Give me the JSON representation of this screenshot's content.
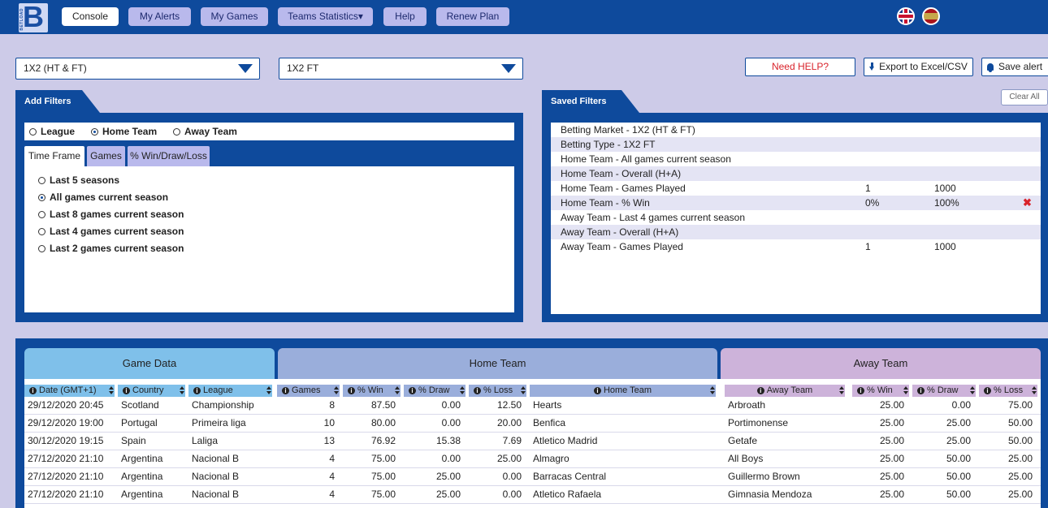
{
  "nav": {
    "logo_letter": "B",
    "logo_sub": "BETLOAD",
    "items": [
      {
        "label": "Console",
        "active": true
      },
      {
        "label": "My Alerts"
      },
      {
        "label": "My Games"
      },
      {
        "label": "Teams Statistics▾"
      },
      {
        "label": "Help"
      },
      {
        "label": "Renew Plan"
      }
    ],
    "flags": [
      "uk-flag",
      "spain-flag"
    ]
  },
  "selects": {
    "betting_market": "1X2 (HT & FT)",
    "betting_type": "1X2 FT"
  },
  "actions": {
    "help": "Need HELP?",
    "export": "Export to Excel/CSV",
    "save_alert": "Save alert"
  },
  "add_filters": {
    "title": "Add Filters",
    "radios": [
      "League",
      "Home Team",
      "Away Team"
    ],
    "selected_radio": "Home Team",
    "tabs": [
      "Time Frame",
      "Games",
      "% Win/Draw/Loss"
    ],
    "active_tab": "Time Frame",
    "options": [
      "Last 5 seasons",
      "All games current season",
      "Last 8 games current season",
      "Last 4 games current season",
      "Last 2 games current season"
    ],
    "selected_option": "All games current season"
  },
  "saved_filters": {
    "title": "Saved Filters",
    "clear_label": "Clear All",
    "rows": [
      {
        "label": "Betting Market - 1X2 (HT & FT)",
        "v1": "",
        "v2": ""
      },
      {
        "label": "Betting Type - 1X2 FT",
        "v1": "",
        "v2": ""
      },
      {
        "label": "Home Team - All games current season",
        "v1": "",
        "v2": ""
      },
      {
        "label": "Home Team - Overall (H+A)",
        "v1": "",
        "v2": ""
      },
      {
        "label": "Home Team - Games Played",
        "v1": "1",
        "v2": "1000"
      },
      {
        "label": "Home Team - % Win",
        "v1": "0%",
        "v2": "100%",
        "remove": "✖"
      },
      {
        "label": "Away Team - Last 4 games current season",
        "v1": "",
        "v2": ""
      },
      {
        "label": "Away Team - Overall (H+A)",
        "v1": "",
        "v2": ""
      },
      {
        "label": "Away Team - Games Played",
        "v1": "1",
        "v2": "1000"
      }
    ]
  },
  "grid": {
    "groups": [
      "Game Data",
      "Home Team",
      "Away Team"
    ],
    "group_colors": [
      "#7fc0ea",
      "#9aaedb",
      "#cdb3da"
    ],
    "headers": [
      "Date (GMT+1)",
      "Country",
      "League",
      "Games",
      "% Win",
      "% Draw",
      "% Loss",
      "Home Team",
      "Away Team",
      "% Win",
      "% Draw",
      "% Loss"
    ],
    "rows": [
      [
        "29/12/2020 20:45",
        "Scotland",
        "Championship",
        "8",
        "87.50",
        "0.00",
        "12.50",
        "Hearts",
        "Arbroath",
        "25.00",
        "0.00",
        "75.00"
      ],
      [
        "29/12/2020 19:00",
        "Portugal",
        "Primeira liga",
        "10",
        "80.00",
        "0.00",
        "20.00",
        "Benfica",
        "Portimonense",
        "25.00",
        "25.00",
        "50.00"
      ],
      [
        "30/12/2020 19:15",
        "Spain",
        "Laliga",
        "13",
        "76.92",
        "15.38",
        "7.69",
        "Atletico Madrid",
        "Getafe",
        "25.00",
        "25.00",
        "50.00"
      ],
      [
        "27/12/2020 21:10",
        "Argentina",
        "Nacional B",
        "4",
        "75.00",
        "0.00",
        "25.00",
        "Almagro",
        "All Boys",
        "25.00",
        "50.00",
        "25.00"
      ],
      [
        "27/12/2020 21:10",
        "Argentina",
        "Nacional B",
        "4",
        "75.00",
        "25.00",
        "0.00",
        "Barracas Central",
        "Guillermo Brown",
        "25.00",
        "50.00",
        "25.00"
      ],
      [
        "27/12/2020 21:10",
        "Argentina",
        "Nacional B",
        "4",
        "75.00",
        "25.00",
        "0.00",
        "Atletico Rafaela",
        "Gimnasia Mendoza",
        "25.00",
        "50.00",
        "25.00"
      ]
    ]
  }
}
